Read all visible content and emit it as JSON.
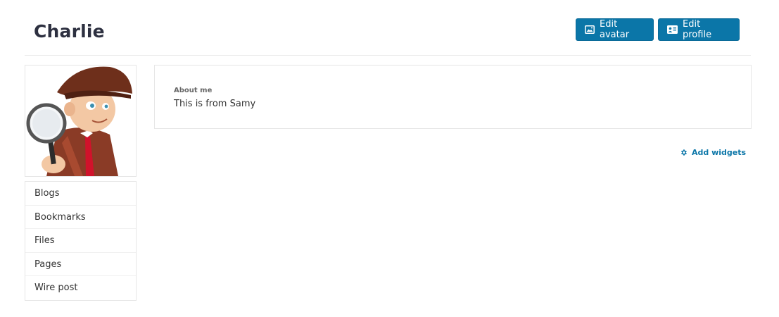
{
  "header": {
    "title": "Charlie",
    "edit_avatar_label": "Edit avatar",
    "edit_profile_label": "Edit profile"
  },
  "sidebar": {
    "items": [
      {
        "label": "Blogs"
      },
      {
        "label": "Bookmarks"
      },
      {
        "label": "Files"
      },
      {
        "label": "Pages"
      },
      {
        "label": "Wire post"
      }
    ]
  },
  "about": {
    "label": "About me",
    "text": "This is from Samy"
  },
  "widgets": {
    "add_label": "Add widgets"
  },
  "icons": {
    "edit_avatar": "image-icon",
    "edit_profile": "id-card-icon",
    "add_widgets": "gear-icon",
    "avatar": "detective-avatar"
  },
  "colors": {
    "accent": "#0b76a8",
    "title": "#2d3040"
  }
}
